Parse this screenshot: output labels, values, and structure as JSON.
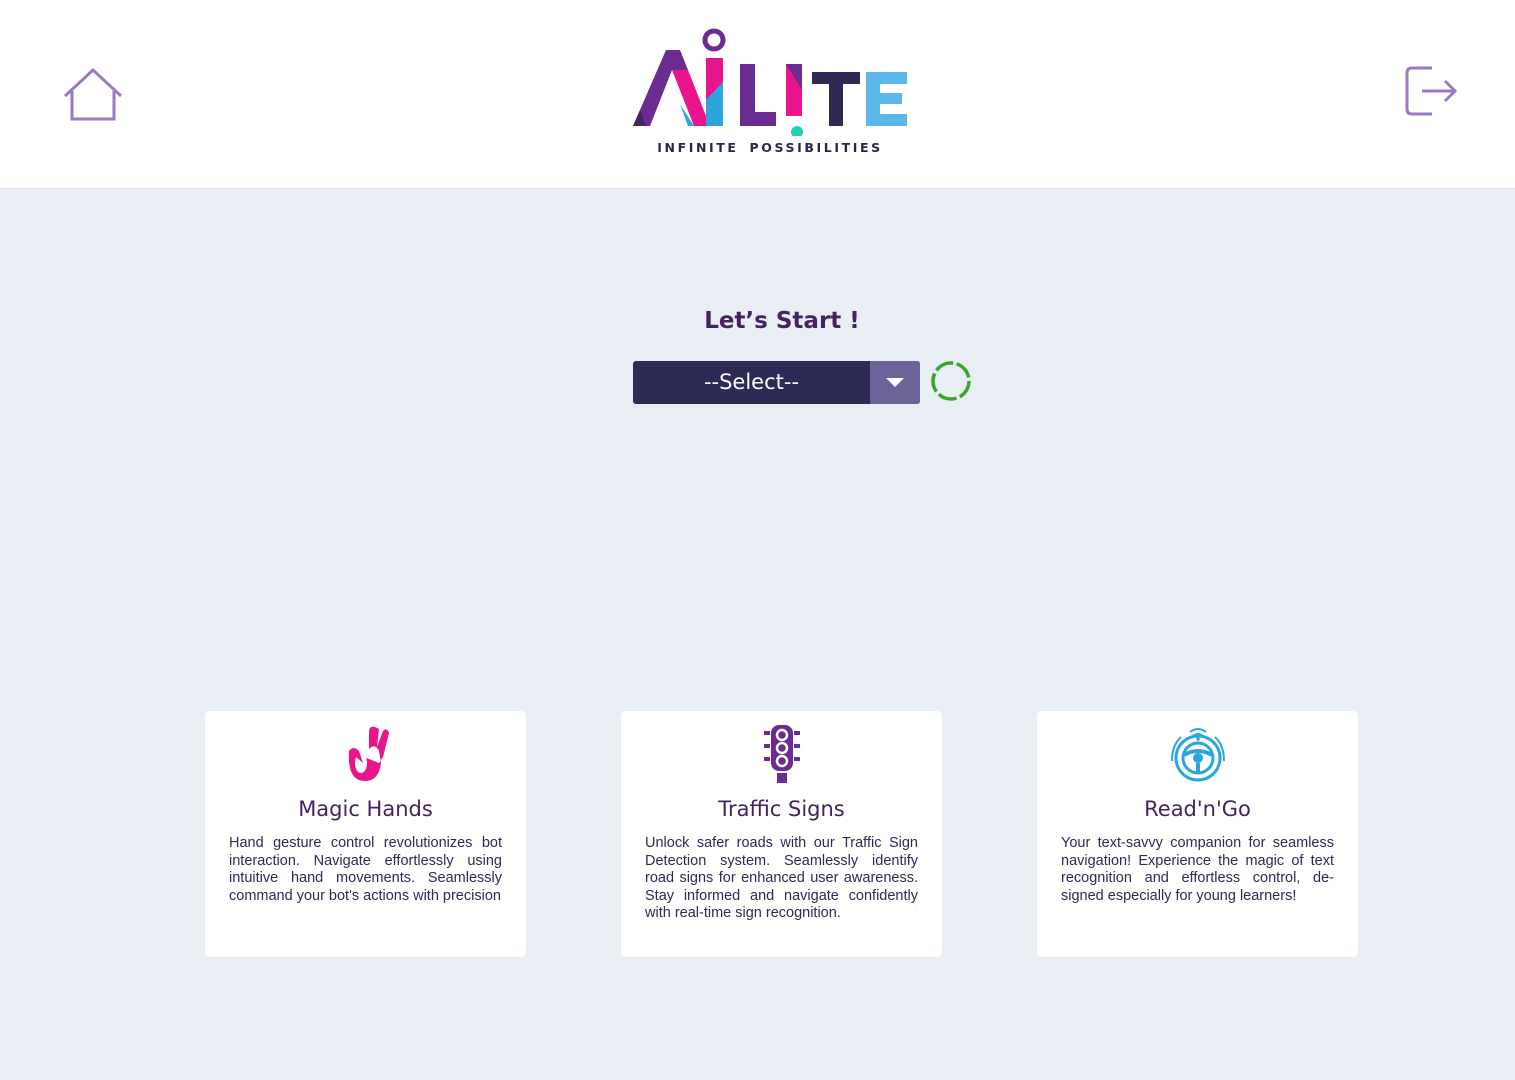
{
  "header": {
    "logo_text": "AiLiTE",
    "logo_tagline": "INFINITE POSSIBILITIES",
    "home_icon": "home-icon",
    "logout_icon": "logout-icon"
  },
  "main": {
    "title": "Let’s Start !",
    "select": {
      "value": "--Select--",
      "icon": "chevron-down-icon"
    },
    "loading_icon": "loading-spinner-icon"
  },
  "cards": [
    {
      "icon": "hand-gesture-icon",
      "title": "Magic Hands",
      "description": "Hand gesture control revolutionizes bot interaction. Navigate effortlessly using intuitive hand movements. Seamlessly command your bot's actions with precision"
    },
    {
      "icon": "traffic-light-icon",
      "title": "Traffic Signs",
      "description": "Unlock safer roads with our Traffic Sign Detection system. Seamlessly identify road signs for enhanced user awareness. Stay informed and navigate confidently with real-time sign recognition."
    },
    {
      "icon": "steering-wheel-icon",
      "title": "Read'n'Go",
      "description": "Your text-savvy companion for seamless navigation! Experience the magic of text recognition and effortless control, de-signed especially for young learners!"
    }
  ],
  "colors": {
    "background": "#e9eef5",
    "header_bg": "#ffffff",
    "primary_dark": "#2d2a55",
    "title_purple": "#44235e",
    "accent_purple": "#9b7ac4",
    "accent_pink": "#e8158c",
    "accent_blue": "#2aa6dc",
    "spinner_green": "#3aa623"
  }
}
